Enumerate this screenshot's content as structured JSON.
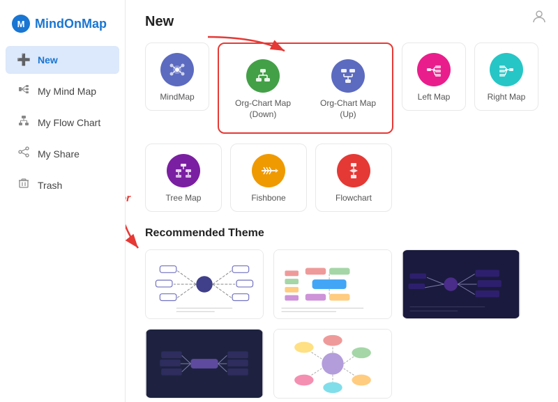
{
  "app": {
    "logo": "MindOnMap",
    "logo_color": "Mind",
    "logo_rest": "OnMap"
  },
  "sidebar": {
    "items": [
      {
        "id": "new",
        "label": "New",
        "icon": "➕",
        "active": true
      },
      {
        "id": "my-mind-map",
        "label": "My Mind Map",
        "icon": "🗃️",
        "active": false
      },
      {
        "id": "my-flow-chart",
        "label": "My Flow Chart",
        "icon": "↪",
        "active": false
      },
      {
        "id": "my-share",
        "label": "My Share",
        "icon": "🔗",
        "active": false
      },
      {
        "id": "trash",
        "label": "Trash",
        "icon": "🗑️",
        "active": false
      }
    ]
  },
  "main": {
    "new_title": "New",
    "maps": [
      {
        "id": "mindmap",
        "label": "MindMap",
        "color": "#5c6bc0",
        "icon": "💡",
        "highlight": false
      },
      {
        "id": "org-chart-down",
        "label": "Org-Chart Map\n(Down)",
        "color": "#43a047",
        "icon": "⊕",
        "highlight": true
      },
      {
        "id": "org-chart-up",
        "label": "Org-Chart Map (Up)",
        "color": "#5c6bc0",
        "icon": "⊗",
        "highlight": true
      },
      {
        "id": "left-map",
        "label": "Left Map",
        "color": "#e91e8c",
        "icon": "↤",
        "highlight": false
      },
      {
        "id": "right-map",
        "label": "Right Map",
        "color": "#26c6c6",
        "icon": "↦",
        "highlight": false
      },
      {
        "id": "empty1",
        "label": "",
        "color": "transparent",
        "icon": "",
        "highlight": false
      }
    ],
    "maps_row2": [
      {
        "id": "tree-map",
        "label": "Tree Map",
        "color": "#7b1fa2",
        "icon": "⊞",
        "highlight": false
      },
      {
        "id": "fishbone",
        "label": "Fishbone",
        "color": "#ef9a00",
        "icon": "✳",
        "highlight": false
      },
      {
        "id": "flowchart",
        "label": "Flowchart",
        "color": "#e53935",
        "icon": "⊡",
        "highlight": false
      }
    ],
    "theme_title": "Recommended Theme",
    "or_label": "or"
  }
}
